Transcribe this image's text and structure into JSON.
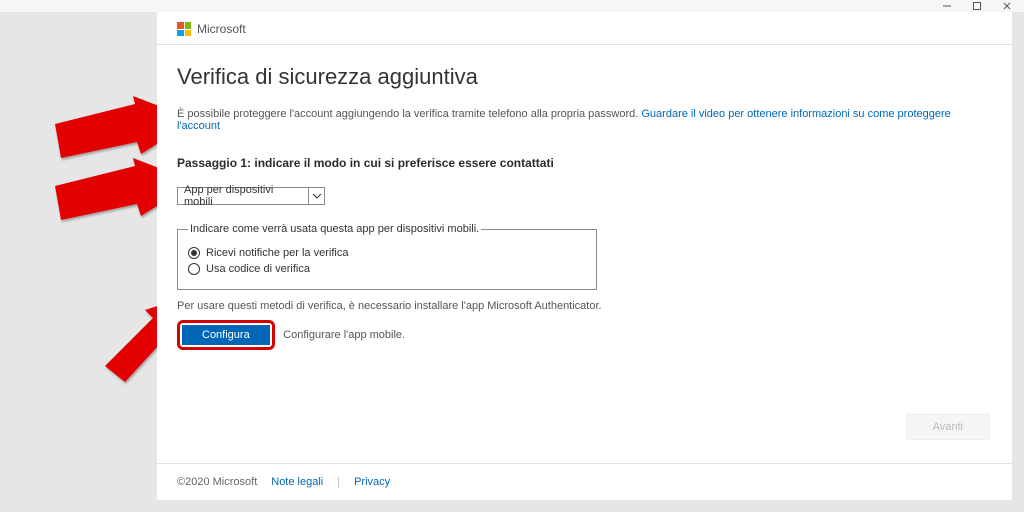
{
  "brand": "Microsoft",
  "window_buttons": {
    "min": "—",
    "max": "▢",
    "close": "✕"
  },
  "title": "Verifica di sicurezza aggiuntiva",
  "intro_text": "È possibile proteggere l'account aggiungendo la verifica tramite telefono alla propria password. ",
  "intro_link": "Guardare il video per ottenere informazioni su come proteggere l'account",
  "step1_label": "Passaggio 1: indicare il modo in cui si preferisce essere contattati",
  "dropdown_value": "App per dispositivi mobili",
  "fieldset_legend": "Indicare come verrà usata questa app per dispositivi mobili.",
  "radio1_label": "Ricevi notifiche per la verifica",
  "radio2_label": "Usa codice di verifica",
  "note_text": "Per usare questi metodi di verifica, è necessario installare l'app Microsoft Authenticator.",
  "config_button": "Configura",
  "after_button_text": "Configurare l'app mobile.",
  "next_button": "Avanti",
  "footer_copyright": "©2020 Microsoft",
  "footer_legal": "Note legali",
  "footer_privacy": "Privacy"
}
